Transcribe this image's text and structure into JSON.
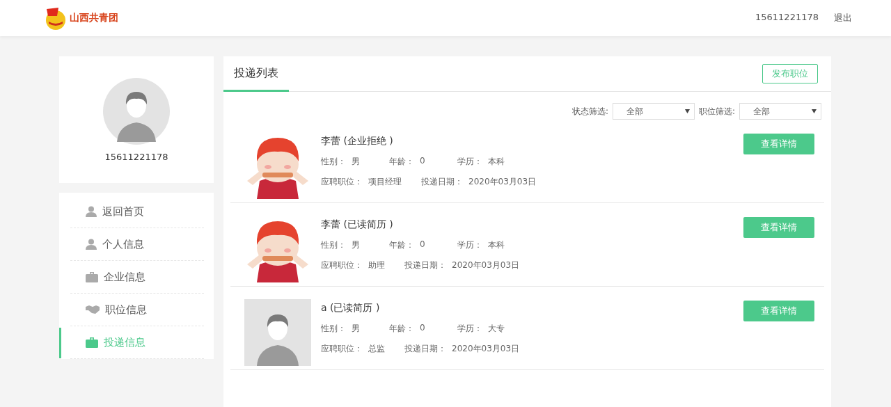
{
  "header": {
    "logo_text": "山西共青团",
    "phone": "15611221178",
    "logout": "退出"
  },
  "profile": {
    "phone": "15611221178"
  },
  "menu": [
    {
      "label": "返回首页",
      "kind": "person",
      "selected": false
    },
    {
      "label": "个人信息",
      "kind": "person",
      "selected": false
    },
    {
      "label": "企业信息",
      "kind": "briefcase",
      "selected": false
    },
    {
      "label": "职位信息",
      "kind": "handshake",
      "selected": false
    },
    {
      "label": "投递信息",
      "kind": "briefcase",
      "selected": true
    }
  ],
  "panel": {
    "tab": "投递列表",
    "publish_button": "发布职位",
    "filters": [
      {
        "label": "状态筛选:",
        "value": "全部"
      },
      {
        "label": "职位筛选:",
        "value": "全部"
      }
    ],
    "applicants": [
      {
        "kind": "picture",
        "title": "李蕾 (企业拒绝 )",
        "lines": [
          [
            {
              "label": "性别：",
              "value": "男"
            },
            {
              "label": "年龄：",
              "value": "0"
            },
            {
              "label": "学历：",
              "value": "本科"
            }
          ],
          [
            {
              "label": "应聘职位：",
              "value": "项目经理"
            },
            {
              "label": "投递日期：",
              "value": "2020年03月03日"
            }
          ]
        ],
        "button": "查看详情"
      },
      {
        "kind": "picture",
        "title": "李蕾 (已读简历 )",
        "lines": [
          [
            {
              "label": "性别：",
              "value": "男"
            },
            {
              "label": "年龄：",
              "value": "0"
            },
            {
              "label": "学历：",
              "value": "本科"
            }
          ],
          [
            {
              "label": "应聘职位：",
              "value": "助理"
            },
            {
              "label": "投递日期：",
              "value": "2020年03月03日"
            }
          ]
        ],
        "button": "查看详情"
      },
      {
        "kind": "avatar",
        "title": "a (已读简历 )",
        "lines": [
          [
            {
              "label": "性别：",
              "value": "男"
            },
            {
              "label": "年龄：",
              "value": "0"
            },
            {
              "label": "学历：",
              "value": "大专"
            }
          ],
          [
            {
              "label": "应聘职位：",
              "value": "总监"
            },
            {
              "label": "投递日期：",
              "value": "2020年03月03日"
            }
          ]
        ],
        "button": "查看详情"
      }
    ]
  }
}
